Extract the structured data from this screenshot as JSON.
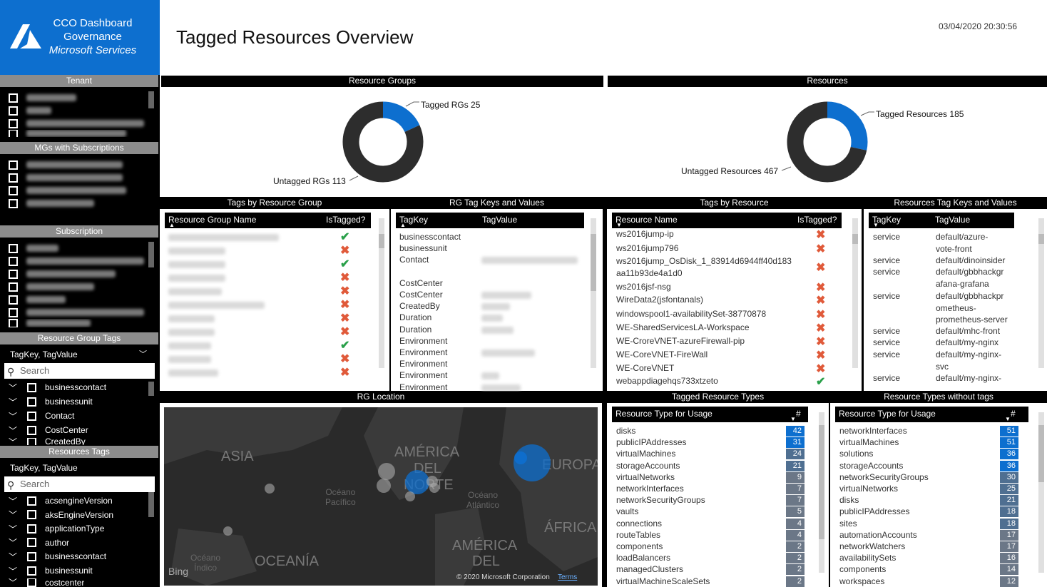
{
  "brand": {
    "line1": "CCO Dashboard",
    "line2": "Governance",
    "line3": "Microsoft Services",
    "color": "#0d6fcf"
  },
  "page": {
    "title": "Tagged Resources Overview",
    "timestamp": "03/04/2020 20:30:56"
  },
  "sidebar": {
    "tenant_header": "Tenant",
    "mgs_header": "MGs with Subscriptions",
    "subscription_header": "Subscription",
    "rg_tags_header": "Resource Group Tags",
    "rg_tags_dropdown": "TagKey, TagValue",
    "rg_tags_search": "Search",
    "rg_tags_items": [
      "businesscontact",
      "businessunit",
      "Contact",
      "CostCenter",
      "CreatedBy"
    ],
    "res_tags_header": "Resources Tags",
    "res_tags_dropdown": "TagKey, TagValue",
    "res_tags_search": "Search",
    "res_tags_items": [
      "acsengineVersion",
      "aksEngineVersion",
      "applicationType",
      "author",
      "businesscontact",
      "businessunit",
      "costcenter"
    ]
  },
  "donuts": {
    "rg": {
      "header": "Resource Groups",
      "tagged_label": "Tagged RGs 25",
      "untagged_label": "Untagged RGs 113",
      "tagged": 25,
      "untagged": 113
    },
    "res": {
      "header": "Resources",
      "tagged_label": "Tagged Resources 185",
      "untagged_label": "Untagged Resources 467",
      "tagged": 185,
      "untagged": 467
    },
    "tagged_color": "#0d6fcf",
    "untagged_color": "#2d2d2d"
  },
  "tags_by_rg": {
    "header": "Tags by Resource Group",
    "col1": "Resource Group Name",
    "col2": "IsTagged?",
    "flags": [
      true,
      false,
      true,
      false,
      false,
      false,
      false,
      false,
      true,
      false,
      false,
      false
    ]
  },
  "rg_tag_kv": {
    "header": "RG Tag Keys and Values",
    "col1": "TagKey",
    "col2": "TagValue",
    "keys": [
      "businesscontact",
      "businessunit",
      "Contact",
      "",
      "CostCenter",
      "CostCenter",
      "CreatedBy",
      "Duration",
      "Duration",
      "Environment",
      "Environment",
      "Environment",
      "Environment",
      "Environment"
    ]
  },
  "tags_by_res": {
    "header": "Tags by Resource",
    "col1": "Resource Name",
    "col2": "IsTagged?",
    "rows": [
      {
        "name": "ws2016jump-ip",
        "tagged": false
      },
      {
        "name": "ws2016jump796",
        "tagged": false
      },
      {
        "name": "ws2016jump_OsDisk_1_83914d6944ff40d183",
        "name2": "aa11b93de4a1d0",
        "tagged": false
      },
      {
        "name": "ws2016jsf-nsg",
        "tagged": false
      },
      {
        "name": "WireData2(jsfontanals)",
        "tagged": false
      },
      {
        "name": "windowspool1-availabilitySet-38770878",
        "tagged": false
      },
      {
        "name": "WE-SharedServicesLA-Workspace",
        "tagged": false
      },
      {
        "name": "WE-CroreVNET-azureFirewall-pip",
        "tagged": false
      },
      {
        "name": "WE-CoreVNET-FireWall",
        "tagged": false
      },
      {
        "name": "WE-CoreVNET",
        "tagged": false
      },
      {
        "name": "webappdiagehqs733xtzeto",
        "tagged": true
      }
    ]
  },
  "res_tag_kv": {
    "header": "Resources Tag Keys and Values",
    "col1": "TagKey",
    "col2": "TagValue",
    "rows": [
      {
        "key": "service",
        "value": "default/azure-",
        "value2": "vote-front"
      },
      {
        "key": "service",
        "value": "default/dinoinsider"
      },
      {
        "key": "service",
        "value": "default/gbbhackgr",
        "value2": "afana-grafana"
      },
      {
        "key": "service",
        "value": "default/gbbhackpr",
        "value2": "ometheus-",
        "value3": "prometheus-server"
      },
      {
        "key": "service",
        "value": "default/mhc-front"
      },
      {
        "key": "service",
        "value": "default/my-nginx"
      },
      {
        "key": "service",
        "value": "default/my-nginx-",
        "value2": "svc"
      },
      {
        "key": "service",
        "value": "default/my-nginx-"
      }
    ]
  },
  "rg_location": {
    "header": "RG Location",
    "labels": {
      "asia": "ASIA",
      "america_norte": "AMÉRICA",
      "del": "DEL",
      "norte": "NORTE",
      "europa": "EUROPA",
      "africa": "ÁFRICA",
      "america_sur": "AMÉRICA",
      "del2": "DEL",
      "oceania": "OCEANÍA",
      "oc_pac": "Océano",
      "pacifico": "Pacífico",
      "oc_atl": "Océano",
      "atlantico": "Atlántico",
      "oc_ind": "Océano",
      "indico": "Índico",
      "bing": "Bing",
      "copyright": "© 2020 Microsoft Corporation",
      "terms": "Terms"
    }
  },
  "tagged_types": {
    "header": "Tagged Resource Types",
    "col1": "Resource Type for Usage",
    "col2": "#",
    "rows": [
      {
        "type": "disks",
        "count": "42"
      },
      {
        "type": "publicIPAddresses",
        "count": "31"
      },
      {
        "type": "virtualMachines",
        "count": "24"
      },
      {
        "type": "storageAccounts",
        "count": "21"
      },
      {
        "type": "virtualNetworks",
        "count": "9"
      },
      {
        "type": "networkInterfaces",
        "count": "7"
      },
      {
        "type": "networkSecurityGroups",
        "count": "7"
      },
      {
        "type": "vaults",
        "count": "5"
      },
      {
        "type": "connections",
        "count": "4"
      },
      {
        "type": "routeTables",
        "count": "4"
      },
      {
        "type": "components",
        "count": "2"
      },
      {
        "type": "loadBalancers",
        "count": "2"
      },
      {
        "type": "managedClusters",
        "count": "2"
      },
      {
        "type": "virtualMachineScaleSets",
        "count": "2"
      }
    ]
  },
  "untagged_types": {
    "header": "Resource Types without tags",
    "col1": "Resource Type for Usage",
    "col2": "#",
    "rows": [
      {
        "type": "networkInterfaces",
        "count": "51"
      },
      {
        "type": "virtualMachines",
        "count": "51"
      },
      {
        "type": "solutions",
        "count": "36"
      },
      {
        "type": "storageAccounts",
        "count": "36"
      },
      {
        "type": "networkSecurityGroups",
        "count": "30"
      },
      {
        "type": "virtualNetworks",
        "count": "25"
      },
      {
        "type": "disks",
        "count": "21"
      },
      {
        "type": "publicIPAddresses",
        "count": "18"
      },
      {
        "type": "sites",
        "count": "18"
      },
      {
        "type": "automationAccounts",
        "count": "17"
      },
      {
        "type": "networkWatchers",
        "count": "17"
      },
      {
        "type": "availabilitySets",
        "count": "16"
      },
      {
        "type": "components",
        "count": "14"
      },
      {
        "type": "workspaces",
        "count": "12"
      }
    ]
  }
}
